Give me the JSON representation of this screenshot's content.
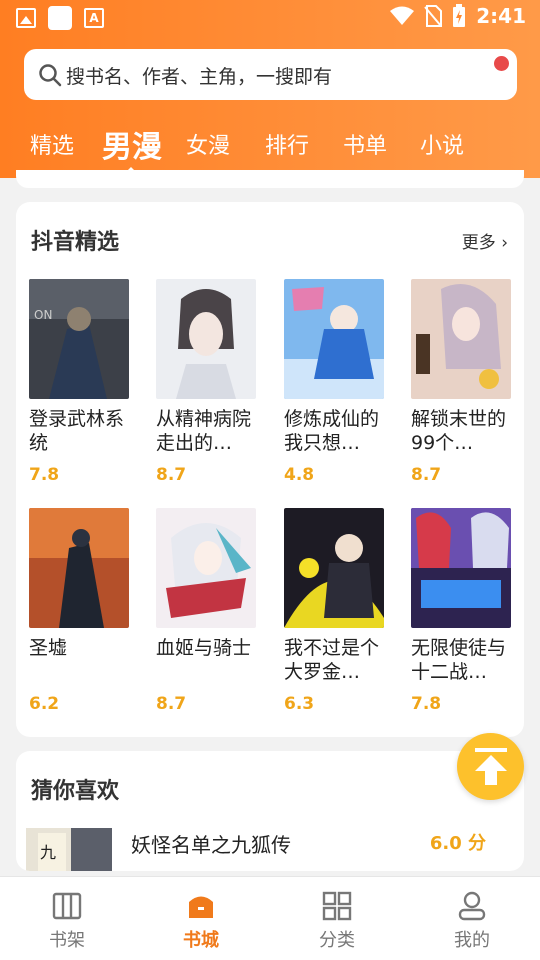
{
  "status_bar": {
    "time": "2:41"
  },
  "search": {
    "placeholder": "搜书名、作者、主角，一搜即有"
  },
  "tabs": [
    {
      "label": "精选"
    },
    {
      "label": "男漫"
    },
    {
      "label": "女漫"
    },
    {
      "label": "排行"
    },
    {
      "label": "书单"
    },
    {
      "label": "小说"
    }
  ],
  "active_tab": "男漫",
  "section": {
    "title": "抖音精选",
    "more_label": "更多",
    "books": [
      {
        "title": "登录武林系统",
        "score": "7.8"
      },
      {
        "title": "从精神病院走出的…",
        "score": "8.7"
      },
      {
        "title": "修炼成仙的我只想…",
        "score": "4.8"
      },
      {
        "title": "解锁末世的99个…",
        "score": "8.7"
      },
      {
        "title": "圣墟",
        "score": "6.2"
      },
      {
        "title": "血姬与骑士",
        "score": "8.7"
      },
      {
        "title": "我不过是个大罗金…",
        "score": "6.3"
      },
      {
        "title": "无限使徒与十二战…",
        "score": "7.8"
      }
    ]
  },
  "recommend": {
    "title": "猜你喜欢",
    "item": {
      "title": "妖怪名单之九狐传",
      "score": "6.0 分"
    }
  },
  "bottom_nav": [
    {
      "label": "书架"
    },
    {
      "label": "书城"
    },
    {
      "label": "分类"
    },
    {
      "label": "我的"
    }
  ],
  "colors": {
    "accent": "#ff8a30",
    "score": "#f0a519",
    "active_nav": "#f07a1b"
  }
}
